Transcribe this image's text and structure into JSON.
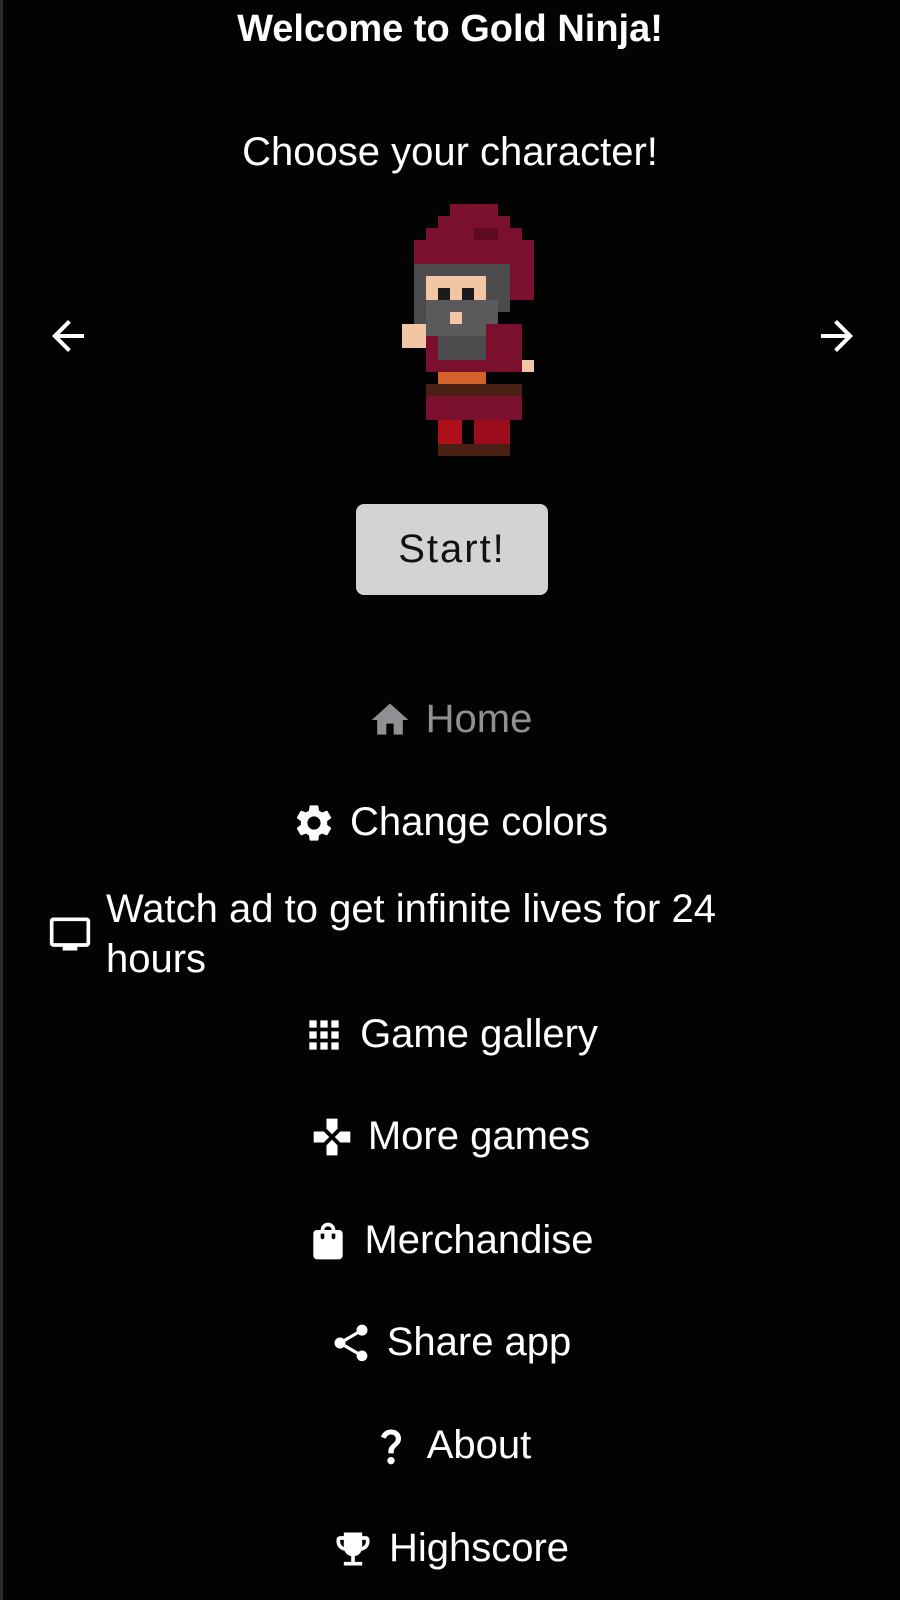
{
  "header": {
    "title": "Welcome to Gold Ninja!",
    "subtitle": "Choose your character!"
  },
  "character_select": {
    "prev_icon": "arrow-left-icon",
    "next_icon": "arrow-right-icon",
    "character_icon": "pixel-ninja-character"
  },
  "start_button": {
    "label": "Start!"
  },
  "menu": {
    "items": [
      {
        "label": "Home",
        "icon": "home-icon",
        "active": true
      },
      {
        "label": "Change colors",
        "icon": "gear-icon"
      },
      {
        "label": "Watch ad to get infinite lives for 24 hours",
        "icon": "tv-icon"
      },
      {
        "label": "Game gallery",
        "icon": "grid-icon"
      },
      {
        "label": "More games",
        "icon": "gamepad-icon"
      },
      {
        "label": "Merchandise",
        "icon": "shopping-bag-icon"
      },
      {
        "label": "Share app",
        "icon": "share-icon"
      },
      {
        "label": "About",
        "icon": "question-icon"
      },
      {
        "label": "Highscore",
        "icon": "trophy-icon"
      }
    ]
  },
  "colors": {
    "background": "#040304",
    "button_bg": "#d3d3d6",
    "active_item": "#8f8f94",
    "text": "#ffffff"
  }
}
